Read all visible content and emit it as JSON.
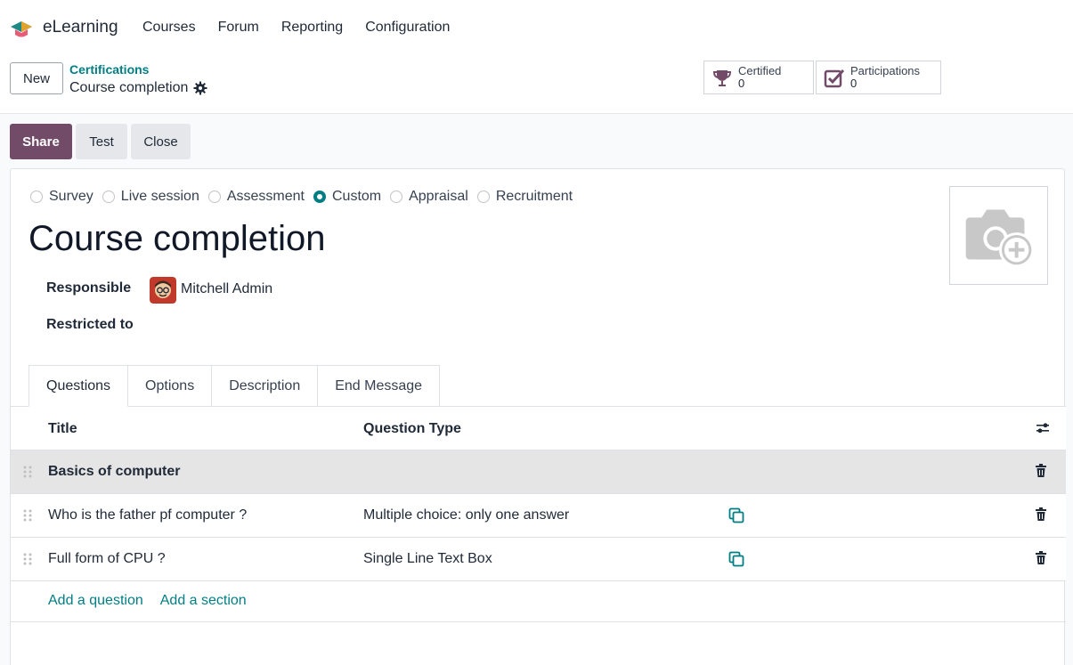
{
  "navbar": {
    "app_name": "eLearning",
    "menu": [
      "Courses",
      "Forum",
      "Reporting",
      "Configuration"
    ]
  },
  "control_panel": {
    "new_label": "New",
    "breadcrumb": "Certifications",
    "record_name": "Course completion",
    "smart_buttons": [
      {
        "label": "Certified",
        "value": "0",
        "icon": "trophy-icon"
      },
      {
        "label": "Participations",
        "value": "0",
        "icon": "checkbox-icon"
      }
    ]
  },
  "actions": {
    "share": "Share",
    "test": "Test",
    "close": "Close"
  },
  "form": {
    "survey_types": [
      {
        "label": "Survey",
        "checked": false
      },
      {
        "label": "Live session",
        "checked": false
      },
      {
        "label": "Assessment",
        "checked": false
      },
      {
        "label": "Custom",
        "checked": true
      },
      {
        "label": "Appraisal",
        "checked": false
      },
      {
        "label": "Recruitment",
        "checked": false
      }
    ],
    "title": "Course completion",
    "responsible_label": "Responsible",
    "responsible_name": "Mitchell Admin",
    "restricted_label": "Restricted to",
    "tabs": [
      "Questions",
      "Options",
      "Description",
      "End Message"
    ],
    "active_tab": "Questions"
  },
  "questions": {
    "col_title": "Title",
    "col_type": "Question Type",
    "rows": [
      {
        "title": "Basics of computer",
        "type": "",
        "section": true
      },
      {
        "title": "Who is the father pf computer ?",
        "type": "Multiple choice: only one answer",
        "section": false
      },
      {
        "title": "Full form of CPU ?",
        "type": "Single Line Text Box",
        "section": false
      }
    ],
    "add_question": "Add a question",
    "add_section": "Add a section"
  },
  "colors": {
    "primary": "#714b67",
    "accent": "#017e84"
  }
}
